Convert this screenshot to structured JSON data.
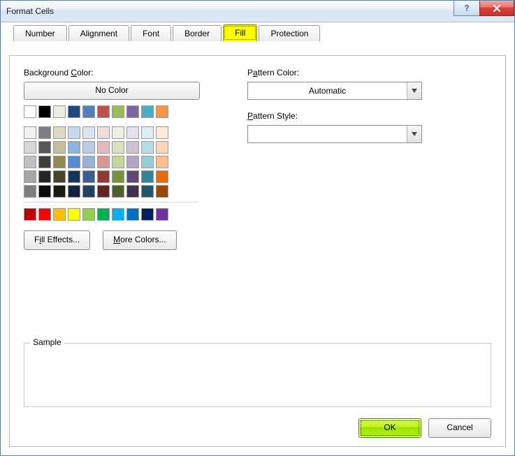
{
  "window": {
    "title": "Format Cells"
  },
  "tabs": {
    "items": [
      "Number",
      "Alignment",
      "Font",
      "Border",
      "Fill",
      "Protection"
    ],
    "active_index": 4
  },
  "fill": {
    "bgcolor_label": "Background Color:",
    "bgcolor_label_ul_char": "C",
    "no_color_label": "No Color",
    "fill_effects_label": "Fill Effects...",
    "fill_effects_ul_char": "I",
    "more_colors_label": "More Colors...",
    "more_colors_ul_char": "M",
    "pattern_color_label": "Pattern Color:",
    "pattern_color_ul_char": "A",
    "pattern_color_value": "Automatic",
    "pattern_style_label": "Pattern Style:",
    "pattern_style_ul_char": "P",
    "pattern_style_value": ""
  },
  "color_rows": [
    [
      "#ffffff",
      "#000000",
      "#eeece1",
      "#1f497d",
      "#4f81bd",
      "#c0504d",
      "#9bbb59",
      "#8064a2",
      "#4bacc6",
      "#f79646"
    ],
    [
      "#f2f2f2",
      "#7f7f7f",
      "#ddd9c3",
      "#c6d9f0",
      "#dbe5f1",
      "#f2dcdb",
      "#ebf1dd",
      "#e5e0ec",
      "#dbeef3",
      "#fdeada"
    ],
    [
      "#d8d8d8",
      "#595959",
      "#c4bd97",
      "#8db3e2",
      "#b8cce4",
      "#e5b9b7",
      "#d7e3bc",
      "#ccc1d9",
      "#b7dde8",
      "#fbd5b5"
    ],
    [
      "#bfbfbf",
      "#3f3f3f",
      "#938953",
      "#548dd4",
      "#95b3d7",
      "#d99694",
      "#c3d69b",
      "#b2a2c7",
      "#92cddc",
      "#fac08f"
    ],
    [
      "#a5a5a5",
      "#262626",
      "#494429",
      "#17365d",
      "#366092",
      "#953734",
      "#76923c",
      "#5f497a",
      "#31859b",
      "#e36c09"
    ],
    [
      "#7f7f7f",
      "#0c0c0c",
      "#1d1b10",
      "#0f243e",
      "#244061",
      "#632423",
      "#4f6128",
      "#3f3151",
      "#205867",
      "#974806"
    ]
  ],
  "standard_row": [
    "#c00000",
    "#ff0000",
    "#ffc000",
    "#ffff00",
    "#92d050",
    "#00b050",
    "#00b0f0",
    "#0070c0",
    "#002060",
    "#7030a0"
  ],
  "sample": {
    "label": "Sample"
  },
  "buttons": {
    "ok": "OK",
    "cancel": "Cancel"
  }
}
